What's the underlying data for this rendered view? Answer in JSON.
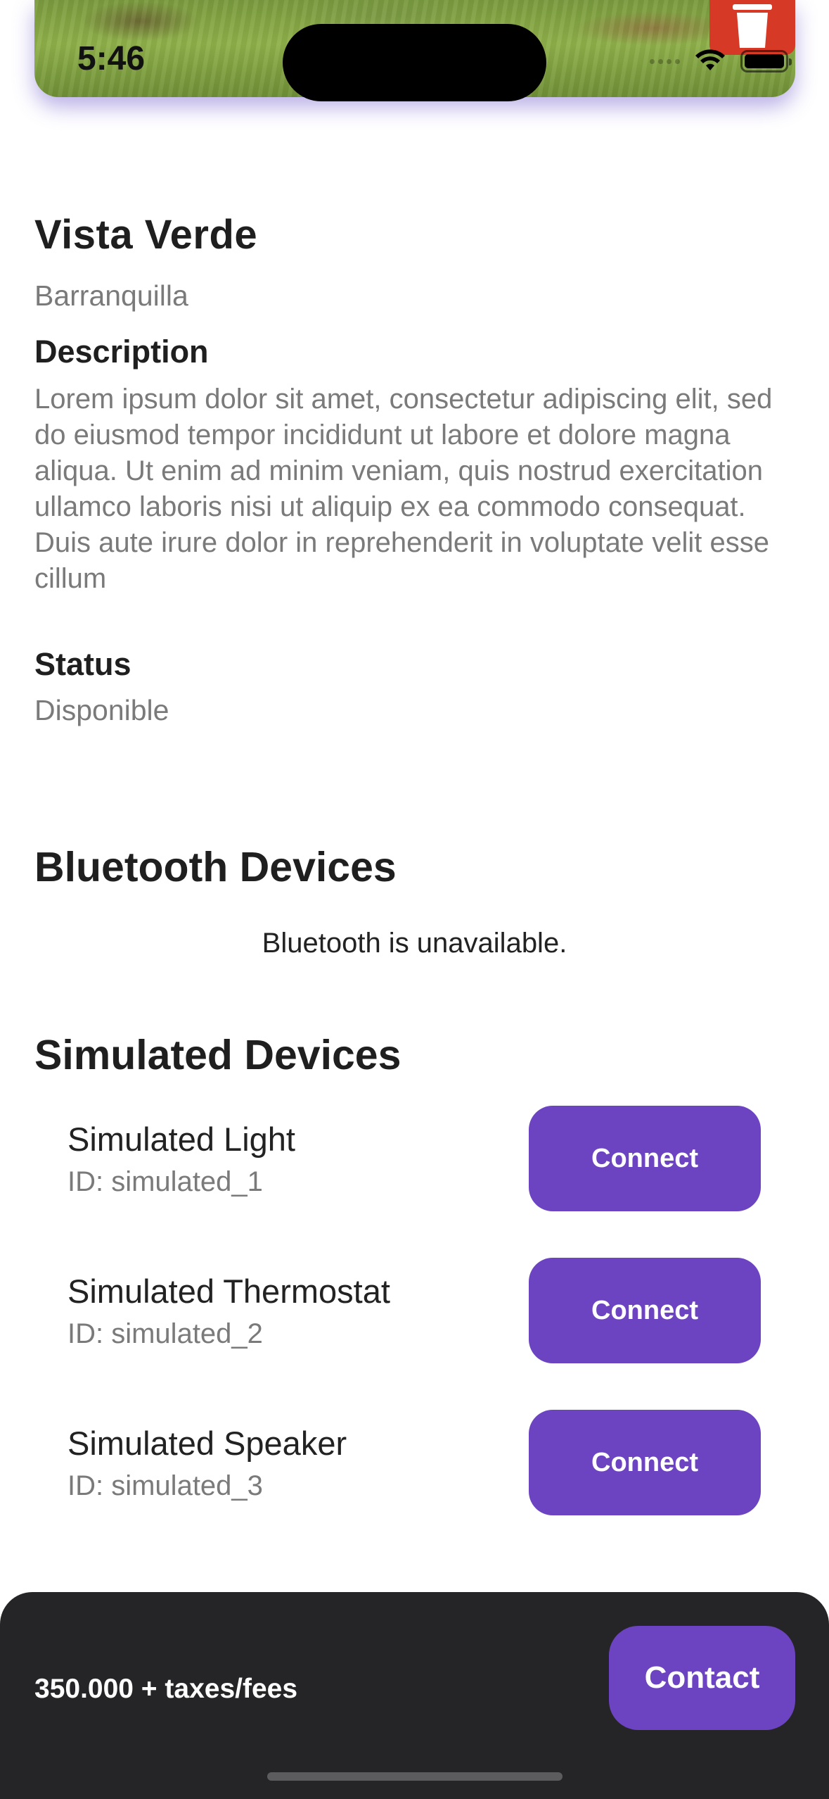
{
  "status_bar": {
    "time": "5:46"
  },
  "property": {
    "title": "Vista Verde",
    "city": "Barranquilla",
    "description_label": "Description",
    "description": "Lorem ipsum dolor sit amet, consectetur adipiscing elit, sed do eiusmod tempor incididunt ut labore et dolore magna aliqua. Ut enim ad minim veniam, quis nostrud exercitation ullamco laboris nisi ut aliquip ex ea commodo consequat. Duis aute irure dolor in reprehenderit in voluptate velit esse cillum",
    "status_label": "Status",
    "status_value": "Disponible"
  },
  "bluetooth": {
    "heading": "Bluetooth Devices",
    "message": "Bluetooth is unavailable."
  },
  "simulated": {
    "heading": "Simulated Devices",
    "devices": [
      {
        "name": "Simulated Light",
        "id": "ID: simulated_1",
        "button": "Connect"
      },
      {
        "name": "Simulated Thermostat",
        "id": "ID: simulated_2",
        "button": "Connect"
      },
      {
        "name": "Simulated Speaker",
        "id": "ID: simulated_3",
        "button": "Connect"
      }
    ]
  },
  "footer": {
    "price": "350.000  + taxes/fees",
    "contact_label": "Contact"
  },
  "colors": {
    "accent": "#6c43c1",
    "delete": "#d63a27",
    "bottom_bar": "#252527"
  },
  "icons": {
    "delete": "trash-icon",
    "wifi": "wifi-icon",
    "battery": "battery-icon"
  }
}
